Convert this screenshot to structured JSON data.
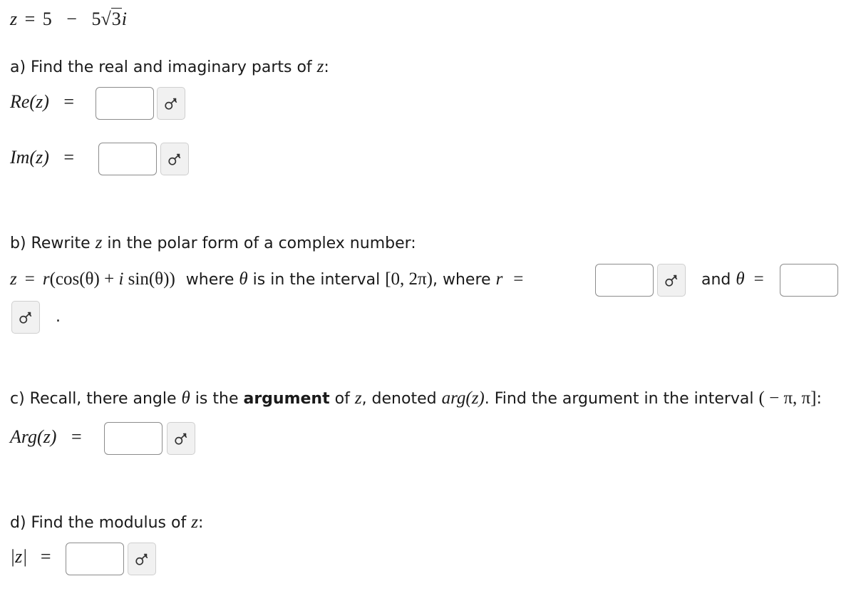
{
  "problem": {
    "z_lhs": "z",
    "equals": "=",
    "z_real": "5",
    "z_minus": "−",
    "z_coef": "5",
    "z_radical": "√",
    "z_radicand": "3",
    "z_i": "i"
  },
  "part_a": {
    "prompt_text": "a) Find the real and imaginary parts of ",
    "prompt_var": "z",
    "prompt_end": ":",
    "re_label": "Re(z)",
    "re_eq": "=",
    "im_label": "Im(z)",
    "im_eq": "="
  },
  "part_b": {
    "prompt_text": "b) Rewrite ",
    "prompt_var": "z",
    "prompt_rest": " in the polar form of a complex number:",
    "formula_lhs": "z",
    "formula_eq": "=",
    "formula_r": "r",
    "formula_body": "(cos(θ) + ",
    "formula_i": "i",
    "formula_sin": " sin(θ))",
    "where_text": "where ",
    "theta": "θ",
    "interval_text": " is in the interval ",
    "interval": "[0, 2π)",
    "where_r_text": ", where ",
    "r_var": "r",
    "r_eq": "=",
    "and_text": "and ",
    "theta_eq": "=",
    "period": "."
  },
  "part_c": {
    "prompt_text1": "c) Recall, there angle ",
    "theta": "θ",
    "prompt_text2": " is the ",
    "bold_word": "argument",
    "prompt_text3": " of ",
    "z_var": "z",
    "prompt_text4": ", denoted ",
    "arg_expr": "arg(z)",
    "prompt_text5": ". Find the argument in the interval ",
    "interval": "( − π, π]",
    "prompt_end": ":",
    "label": "Arg(z)",
    "eq": "="
  },
  "part_d": {
    "prompt_text": "d) Find the modulus of ",
    "prompt_var": "z",
    "prompt_end": ":",
    "label": "|z|",
    "eq": "="
  },
  "icons": {
    "preview": "preview-key-icon"
  }
}
